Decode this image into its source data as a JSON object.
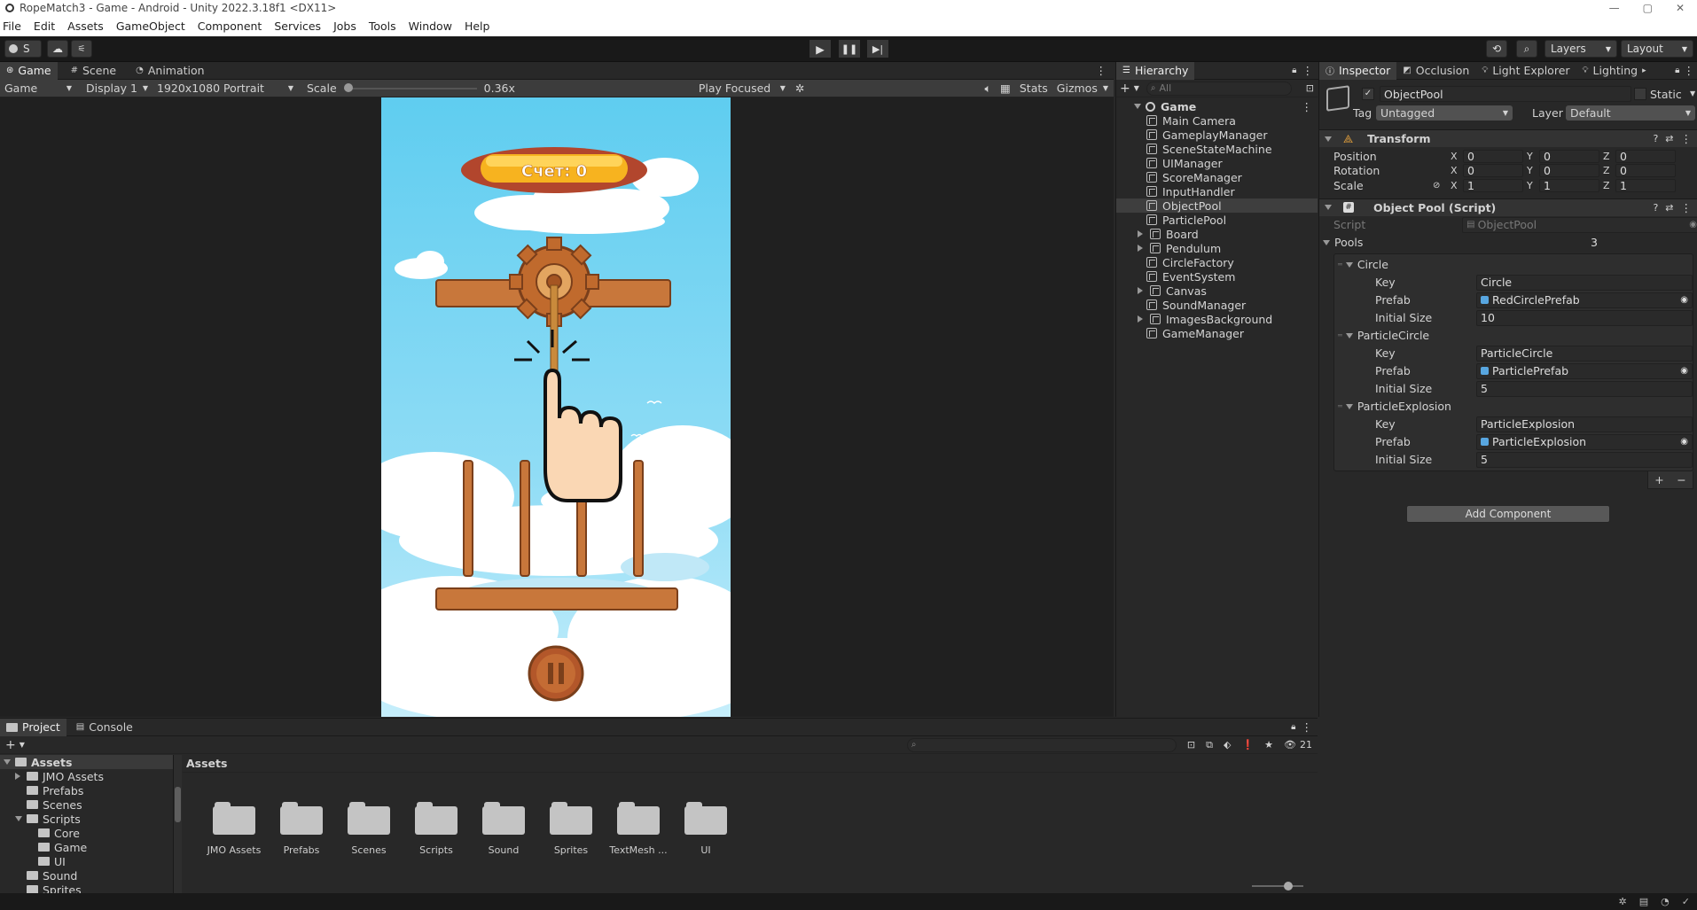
{
  "window": {
    "title": "RopeMatch3 - Game - Android - Unity 2022.3.18f1 <DX11>"
  },
  "menu": [
    "File",
    "Edit",
    "Assets",
    "GameObject",
    "Component",
    "Services",
    "Jobs",
    "Tools",
    "Window",
    "Help"
  ],
  "toolbar": {
    "account": "S",
    "layers": "Layers",
    "layout": "Layout"
  },
  "game_panel": {
    "tabs": [
      "Game",
      "Scene",
      "Animation"
    ],
    "display_mode": "Game",
    "display": "Display 1",
    "resolution": "1920x1080 Portrait",
    "scale_label": "Scale",
    "scale_value": "0.36x",
    "play_focused": "Play Focused",
    "stats": "Stats",
    "gizmos": "Gizmos",
    "score_text": "Счет: 0"
  },
  "hierarchy": {
    "tab": "Hierarchy",
    "search_placeholder": "All",
    "root": "Game",
    "items": [
      {
        "label": "Main Camera",
        "expandable": false
      },
      {
        "label": "GameplayManager",
        "expandable": false
      },
      {
        "label": "SceneStateMachine",
        "expandable": false
      },
      {
        "label": "UIManager",
        "expandable": false
      },
      {
        "label": "ScoreManager",
        "expandable": false
      },
      {
        "label": "InputHandler",
        "expandable": false
      },
      {
        "label": "ObjectPool",
        "expandable": false,
        "selected": true
      },
      {
        "label": "ParticlePool",
        "expandable": false
      },
      {
        "label": "Board",
        "expandable": true
      },
      {
        "label": "Pendulum",
        "expandable": true
      },
      {
        "label": "CircleFactory",
        "expandable": false
      },
      {
        "label": "EventSystem",
        "expandable": false
      },
      {
        "label": "Canvas",
        "expandable": true
      },
      {
        "label": "SoundManager",
        "expandable": false
      },
      {
        "label": "ImagesBackground",
        "expandable": true
      },
      {
        "label": "GameManager",
        "expandable": false
      }
    ]
  },
  "inspector": {
    "tabs": [
      "Inspector",
      "Occlusion",
      "Light Explorer",
      "Lighting"
    ],
    "object_name": "ObjectPool",
    "static_label": "Static",
    "tag_label": "Tag",
    "tag_value": "Untagged",
    "layer_label": "Layer",
    "layer_value": "Default",
    "transform": {
      "title": "Transform",
      "rows": [
        {
          "label": "Position",
          "x": "0",
          "y": "0",
          "z": "0"
        },
        {
          "label": "Rotation",
          "x": "0",
          "y": "0",
          "z": "0"
        },
        {
          "label": "Scale",
          "x": "1",
          "y": "1",
          "z": "1"
        }
      ]
    },
    "script_component": {
      "title": "Object Pool (Script)",
      "script_label": "Script",
      "script_value": "ObjectPool",
      "pools_label": "Pools",
      "pools_count": "3",
      "key_label": "Key",
      "prefab_label": "Prefab",
      "size_label": "Initial Size",
      "pools": [
        {
          "name": "Circle",
          "key": "Circle",
          "prefab": "RedCirclePrefab",
          "size": "10"
        },
        {
          "name": "ParticleCircle",
          "key": "ParticleCircle",
          "prefab": "ParticlePrefab",
          "size": "5"
        },
        {
          "name": "ParticleExplosion",
          "key": "ParticleExplosion",
          "prefab": "ParticleExplosion",
          "size": "5"
        }
      ]
    },
    "add_component": "Add Component"
  },
  "project": {
    "tabs": [
      "Project",
      "Console"
    ],
    "breadcrumb": "Assets",
    "tree": [
      {
        "label": "Assets",
        "level": 0,
        "open": true,
        "bold": true
      },
      {
        "label": "JMO Assets",
        "level": 1,
        "collapsed": true
      },
      {
        "label": "Prefabs",
        "level": 1
      },
      {
        "label": "Scenes",
        "level": 1
      },
      {
        "label": "Scripts",
        "level": 1,
        "open": true
      },
      {
        "label": "Core",
        "level": 2
      },
      {
        "label": "Game",
        "level": 2
      },
      {
        "label": "UI",
        "level": 2
      },
      {
        "label": "Sound",
        "level": 1
      },
      {
        "label": "Sprites",
        "level": 1
      }
    ],
    "folders": [
      "JMO Assets",
      "Prefabs",
      "Scenes",
      "Scripts",
      "Sound",
      "Sprites",
      "TextMesh ...",
      "UI"
    ],
    "hidden_count": "21"
  },
  "colors": {
    "accent": "#2c5d87",
    "selected_row": "#2c5d87",
    "sky": "#6ad0f0",
    "wood": "#c8773b"
  }
}
